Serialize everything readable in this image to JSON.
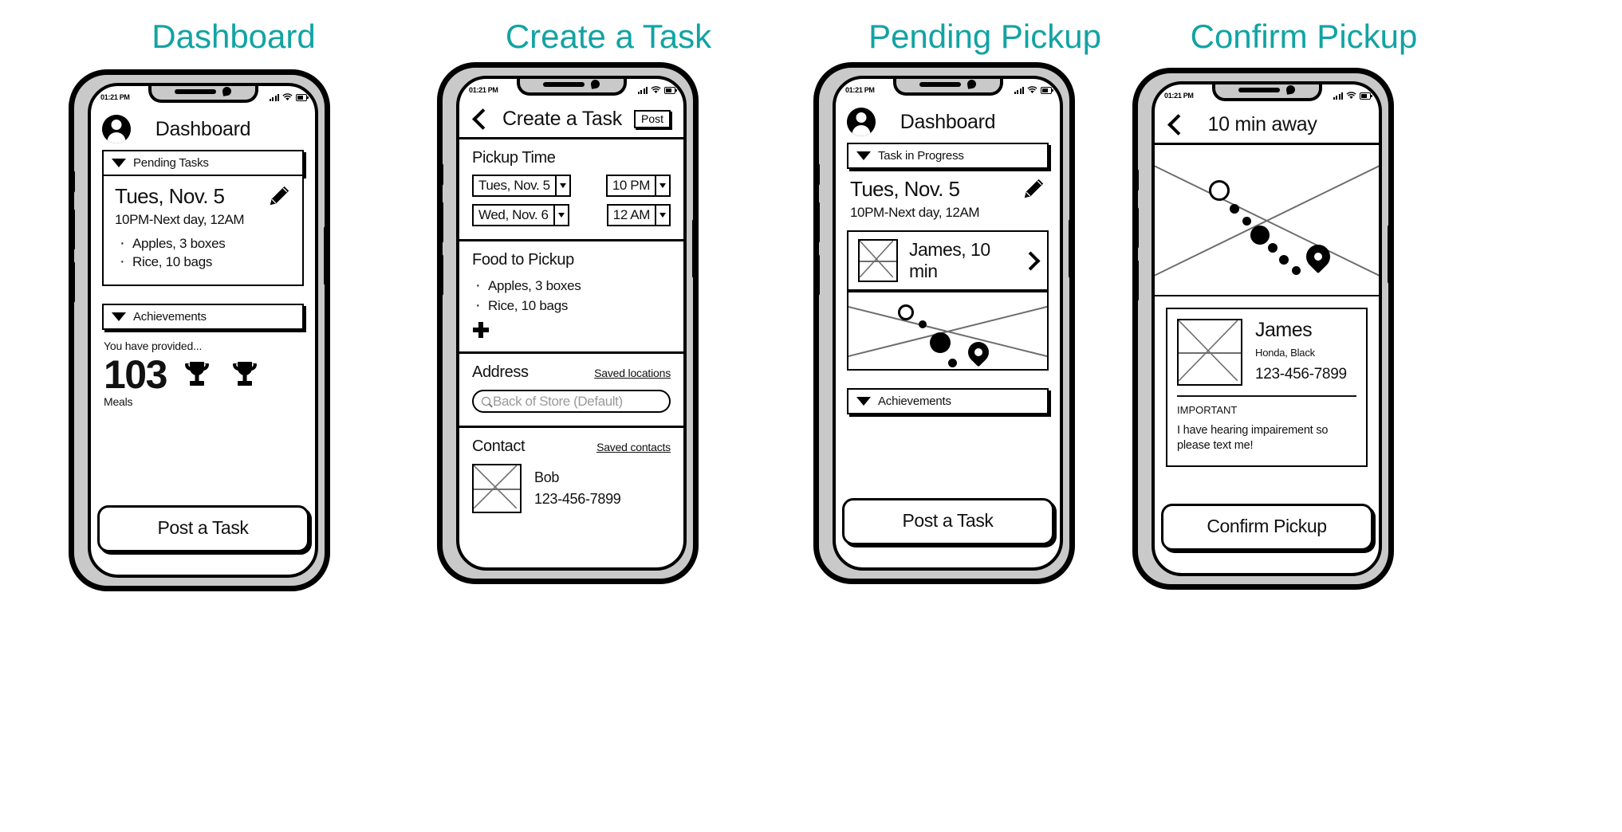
{
  "screens": [
    {
      "caption": "Dashboard",
      "statusbar": {
        "time": "01:21 PM",
        "signal_icon": "cellular-signal-icon",
        "wifi_icon": "wifi-icon",
        "battery_icon": "battery-icon"
      },
      "appbar": {
        "title": "Dashboard",
        "avatar_icon": "user-avatar-icon"
      },
      "pending": {
        "bar_label": "Pending Tasks",
        "caret_icon": "caret-down-icon",
        "date": "Tues, Nov. 5",
        "time_range": "10PM-Next day, 12AM",
        "edit_icon": "pencil-icon",
        "items": [
          "Apples, 3 boxes",
          "Rice, 10 bags"
        ]
      },
      "achievements": {
        "bar_label": "Achievements",
        "caret_icon": "caret-down-icon",
        "intro": "You have provided...",
        "count": "103",
        "count_label": "Meals",
        "trophy_icon": "trophy-icon",
        "trophy_count": 2
      },
      "cta": "Post a Task"
    },
    {
      "caption": "Create a Task",
      "statusbar": {
        "time": "01:21 PM"
      },
      "appbar": {
        "back_icon": "chevron-left-icon",
        "title": "Create a Task",
        "post_label": "Post"
      },
      "pickup_time": {
        "title": "Pickup Time",
        "start_date": "Tues, Nov. 5",
        "start_time": "10 PM",
        "end_date": "Wed, Nov. 6",
        "end_time": "12 AM"
      },
      "food": {
        "title": "Food to Pickup",
        "items": [
          "Apples, 3 boxes",
          "Rice, 10 bags"
        ],
        "add_icon": "plus-icon"
      },
      "address": {
        "title": "Address",
        "link": "Saved locations",
        "search_icon": "search-icon",
        "placeholder": "Back of Store (Default)",
        "value": ""
      },
      "contact": {
        "title": "Contact",
        "link": "Saved contacts",
        "avatar_icon": "image-placeholder-icon",
        "name": "Bob",
        "phone": "123-456-7899"
      }
    },
    {
      "caption": "Pending Pickup",
      "statusbar": {
        "time": "01:21 PM"
      },
      "appbar": {
        "title": "Dashboard",
        "avatar_icon": "user-avatar-icon"
      },
      "progress": {
        "bar_label": "Task in Progress",
        "caret_icon": "caret-down-icon",
        "date": "Tues, Nov. 5",
        "time_range": "10PM-Next day, 12AM",
        "edit_icon": "pencil-icon"
      },
      "driver": {
        "avatar_icon": "image-placeholder-icon",
        "label": "James, 10 min",
        "chevron_icon": "chevron-right-icon"
      },
      "map": {
        "icon": "map-placeholder-icon",
        "pin_icon": "map-pin-icon"
      },
      "achievements": {
        "bar_label": "Achievements",
        "caret_icon": "caret-down-icon"
      },
      "cta": "Post a Task"
    },
    {
      "caption": "Confirm Pickup",
      "statusbar": {
        "time": "01:21 PM"
      },
      "appbar": {
        "back_icon": "chevron-left-icon",
        "title": "10 min away"
      },
      "map": {
        "icon": "map-placeholder-icon",
        "pin_icon": "map-pin-icon"
      },
      "info": {
        "avatar_icon": "image-placeholder-icon",
        "name": "James",
        "vehicle": "Honda, Black",
        "phone": "123-456-7899",
        "important_label": "IMPORTANT",
        "note": "I have hearing impairement so please text me!"
      },
      "cta": "Confirm Pickup"
    }
  ],
  "colors": {
    "caption": "#12a3a3",
    "ink": "#000000",
    "phone_body": "#c9c9c9",
    "placeholder": "#9a9a9a",
    "map_line": "#6d6d6d"
  }
}
